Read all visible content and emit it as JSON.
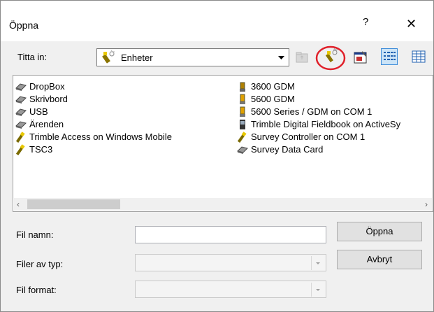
{
  "dialog": {
    "title": "Öppna",
    "help_label": "?",
    "close_label": "✕"
  },
  "look_in": {
    "label": "Titta in:",
    "value": "Enheter"
  },
  "files": {
    "column1": [
      {
        "name": "DropBox",
        "icon": "drive-icon"
      },
      {
        "name": "Skrivbord",
        "icon": "drive-icon"
      },
      {
        "name": "USB",
        "icon": "drive-icon"
      },
      {
        "name": "Ärenden",
        "icon": "drive-icon"
      },
      {
        "name": "Trimble Access on Windows Mobile",
        "icon": "controller-icon"
      },
      {
        "name": "TSC3",
        "icon": "controller-icon"
      }
    ],
    "column2": [
      {
        "name": "3600 GDM",
        "icon": "total-station-icon"
      },
      {
        "name": "5600 GDM",
        "icon": "total-station-icon"
      },
      {
        "name": "5600 Series / GDM on COM 1",
        "icon": "total-station-icon"
      },
      {
        "name": "Trimble Digital Fieldbook on ActiveSy",
        "icon": "handheld-icon"
      },
      {
        "name": "Survey Controller on COM 1",
        "icon": "controller-icon"
      },
      {
        "name": "Survey Data Card",
        "icon": "drive-icon"
      }
    ]
  },
  "form": {
    "filename_label": "Fil namn:",
    "filename_value": "",
    "filetype_label": "Filer av typ:",
    "filetype_value": "",
    "fileformat_label": "Fil format:",
    "fileformat_value": ""
  },
  "buttons": {
    "open": "Öppna",
    "cancel": "Avbryt"
  },
  "colors": {
    "highlight_circle": "#e0202a",
    "dialog_bg": "#f0f0f0"
  }
}
